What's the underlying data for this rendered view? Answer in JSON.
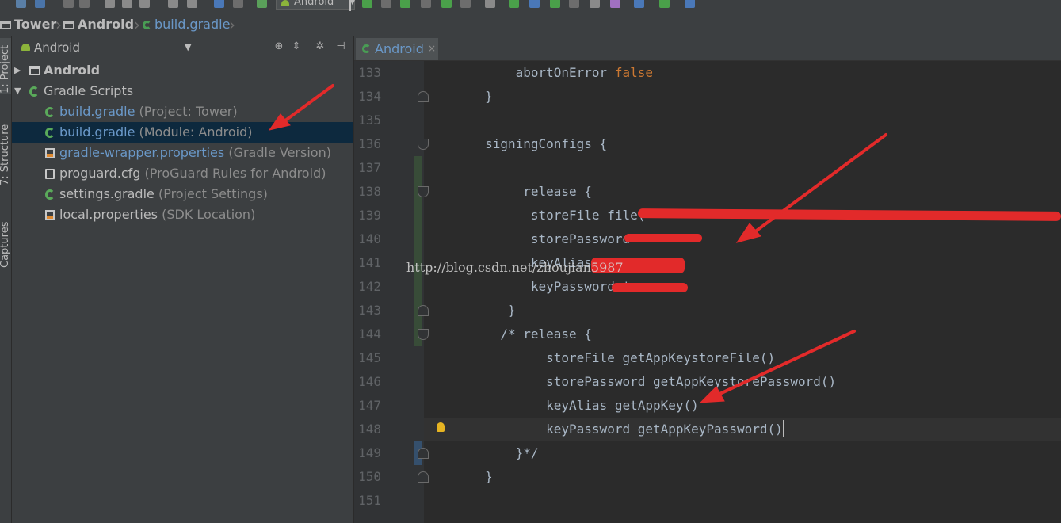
{
  "toolbar": {
    "run_config": "Android"
  },
  "breadcrumb": [
    {
      "label": "Tower",
      "icon": "folder-icon"
    },
    {
      "label": "Android",
      "icon": "folder-icon"
    },
    {
      "label": "build.gradle",
      "icon": "gradle-icon"
    }
  ],
  "side_tabs": [
    "1: Project",
    "7: Structure",
    "Captures"
  ],
  "project_panel": {
    "view_selector": "Android",
    "tree": [
      {
        "name": "Android",
        "hint": "",
        "icon": "folder-icon",
        "expanded": false,
        "level": 0
      },
      {
        "name": "Gradle Scripts",
        "hint": "",
        "icon": "gradle-icon",
        "expanded": true,
        "level": 0
      },
      {
        "name": "build.gradle",
        "hint": " (Project: Tower)",
        "icon": "gradle-icon",
        "level": 1
      },
      {
        "name": "build.gradle",
        "hint": " (Module: Android)",
        "icon": "gradle-icon",
        "level": 1,
        "selected": true
      },
      {
        "name": "gradle-wrapper.properties",
        "hint": " (Gradle Version)",
        "icon": "properties-icon",
        "level": 1
      },
      {
        "name": "proguard.cfg",
        "hint": " (ProGuard Rules for Android)",
        "icon": "file-icon",
        "level": 1
      },
      {
        "name": "settings.gradle",
        "hint": " (Project Settings)",
        "icon": "gradle-icon",
        "level": 1
      },
      {
        "name": "local.properties",
        "hint": " (SDK Location)",
        "icon": "properties-icon",
        "level": 1
      }
    ]
  },
  "editor": {
    "tab_label": "Android",
    "line_numbers": [
      "133",
      "134",
      "135",
      "136",
      "137",
      "138",
      "139",
      "140",
      "141",
      "142",
      "143",
      "144",
      "145",
      "146",
      "147",
      "148",
      "149",
      "150",
      "151"
    ],
    "current_line": "148",
    "code_lines": [
      "            abortOnError false",
      "        }",
      "",
      "        signingConfigs {",
      "",
      "             release {",
      "              storeFile file('",
      "              storePassword '",
      "              keyAlias '",
      "              keyPassword '",
      "           }",
      "          /* release {",
      "                storeFile getAppKeystoreFile()",
      "                storePassword getAppKeystorePassword()",
      "                keyAlias getAppKey()",
      "                keyPassword getAppKeyPassword()",
      "            }*/",
      "        }",
      ""
    ]
  },
  "watermark": "http://blog.csdn.net/zhoujian5987",
  "colors": {
    "annotation": "#e22a2a",
    "keyword": "#cc7832",
    "link_blue": "#6a98c8",
    "selection": "#0d293e"
  }
}
